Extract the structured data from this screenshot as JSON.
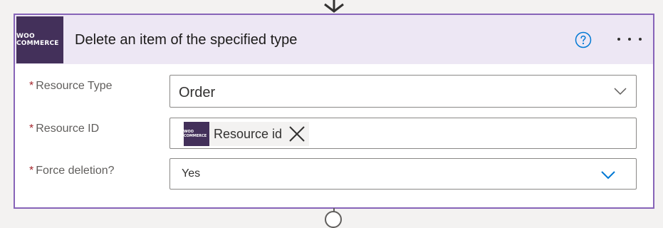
{
  "action": {
    "connector_logo_text": "WOO COMMERCE",
    "title": "Delete an item of the specified type",
    "help_icon": "help-circle-icon",
    "more_icon": "more-horizontal-icon"
  },
  "fields": {
    "resource_type": {
      "required_mark": "*",
      "label": "Resource Type",
      "value": "Order"
    },
    "resource_id": {
      "required_mark": "*",
      "label": "Resource ID",
      "token_logo_text": "WOO COMMERCE",
      "token_label": "Resource id"
    },
    "force_deletion": {
      "required_mark": "*",
      "label": "Force deletion?",
      "value": "Yes"
    }
  },
  "colors": {
    "accent_border": "#8764b8",
    "header_bg": "#ede7f4",
    "logo_bg": "#43305a",
    "required": "#a4262c",
    "chevron_blue": "#0078d4"
  }
}
